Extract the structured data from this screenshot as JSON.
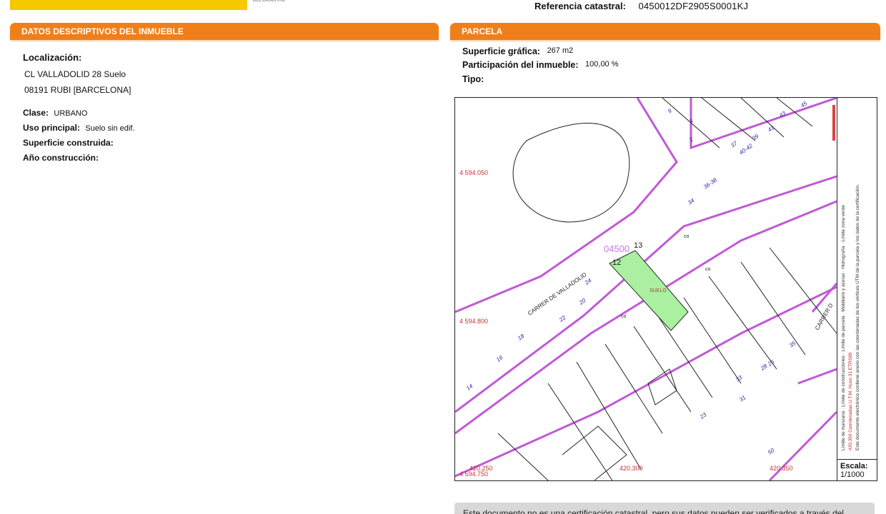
{
  "header": {
    "logo_subtext": "DEL CATASTRO",
    "ref_label": "Referencia catastral:",
    "ref_value": "0450012DF2905S0001KJ"
  },
  "left_section": {
    "title": "DATOS DESCRIPTIVOS DEL INMUEBLE",
    "localizacion_label": "Localización:",
    "address_line1": "CL VALLADOLID 28 Suelo",
    "address_line2": "08191 RUBI [BARCELONA]",
    "clase_label": "Clase:",
    "clase_value": "URBANO",
    "uso_label": "Uso principal:",
    "uso_value": "Suelo sin edif.",
    "superficie_label": "Superficie construida:",
    "ano_label": "Año construcción:"
  },
  "right_section": {
    "title": "PARCELA",
    "superficie_label": "Superficie gráfica:",
    "superficie_value": "267 m2",
    "participacion_label": "Participación del inmueble:",
    "participacion_value": "100,00 %",
    "tipo_label": "Tipo:"
  },
  "map": {
    "coord_y_top": "4 594.050",
    "coord_y_mid": "4 594.800",
    "coord_y_bottom": "4 594.750",
    "coord_x_left": "420.250",
    "coord_x_mid": "420.300",
    "coord_x_right": "420.350",
    "street_label": "CARRER DE VALLADOLID",
    "street_label_2": "CARRER D",
    "parcel_ref": "04500",
    "parcel_label": "SUELO",
    "parcel_number": "12",
    "neighbor_number": "13",
    "co_label": "co",
    "house_numbers": [
      "45",
      "43",
      "41",
      "39",
      "37",
      "40-42",
      "36-38",
      "34",
      "22",
      "20",
      "18",
      "16",
      "14",
      "24",
      "26",
      "31",
      "33",
      "35",
      "50",
      "28",
      "9",
      "4",
      "2",
      "23"
    ],
    "colors": {
      "block_limit": "#c05ad6",
      "parcel_fill": "#aaf0a0",
      "coord_text": "#c33333",
      "number_text": "#2a2aa8",
      "lines": "#222222"
    }
  },
  "legend": {
    "manzana": "Límite de manzana",
    "construcciones": "Límite de construcciones",
    "parcela": "Límite de parcela",
    "mobiliario": "Mobiliario y aceras",
    "hidrografia": "Hidrografía",
    "zona_verde": "Límite zona verde",
    "coords_note": "420,350 Coordenadas U.T.M. Huso 31 ETRS89",
    "doc_note": "Este documento electrónico contiene anexo con las coordenadas de los vértices UTM de la parcela y los datos de la certificación.",
    "scale_label": "Escala:",
    "scale_value": "1/1000"
  },
  "footer": {
    "note": "Este documento no es una certificación catastral, pero sus datos pueden ser verificados a través del"
  }
}
